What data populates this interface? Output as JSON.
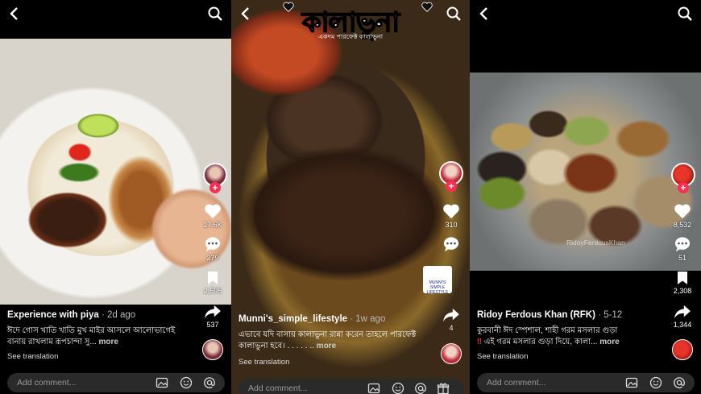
{
  "colors": {
    "accent": "#fe2c55",
    "background": "#000000",
    "comment_box": "#2a2a2a"
  },
  "posts": [
    {
      "author": "Experience with piya",
      "age": "2d ago",
      "caption": "ঈদে গোস খাতি খাতি মুখ মাইর আসলে আলোভাগেই বানায় রাখলাম রূপচান্দা সু...",
      "more": "more",
      "see_translation": "See translation",
      "likes": "17.6K",
      "comments": "279",
      "saves": "2,595",
      "shares": "537",
      "comment_placeholder": "Add comment..."
    },
    {
      "title_overlay": "কালাভুনা",
      "subtitle_overlay": "একদম পারফেক্ট কালাভুনা",
      "author": "Munni's_simple_lifestyle",
      "age": "1w ago",
      "caption": "এভাবে যদি বাসায় কালাভুনা রান্না করেন তাহলে পারফেক্ট কালাভুনা হবে। . . . . . ..",
      "more": "more",
      "see_translation": "See translation",
      "likes": "310",
      "shares": "4",
      "brand_logo": "MUNNI'S SIMPLE LIFESTYLE",
      "comment_placeholder": "Add comment..."
    },
    {
      "author": "Ridoy Ferdous Khan (RFK)",
      "age": "5-12",
      "caption_line1": "কুরবানী ঈদ স্পেশাল, শাহী গরম মসলার গুড়া",
      "caption_line2": "এই গরম মসলার গুড়া দিয়ে, কালা...",
      "more": "more",
      "see_translation": "See translation",
      "watermark": "RidoyFerdousKhan",
      "likes": "8,532",
      "comments": "51",
      "saves": "2,308",
      "shares": "1,344",
      "comment_placeholder": "Add comment..."
    }
  ]
}
